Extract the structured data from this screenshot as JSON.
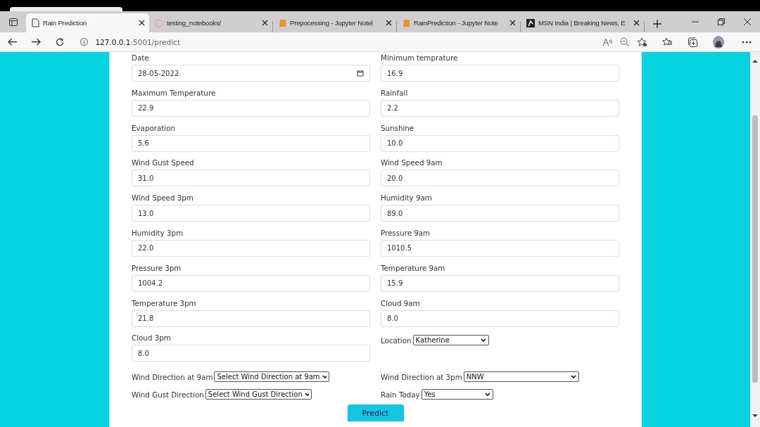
{
  "browser": {
    "tabs": [
      {
        "title": "Rain Prediction",
        "kind": "page",
        "selected": true
      },
      {
        "title": "testing_notebooks/",
        "kind": "spinner",
        "selected": false
      },
      {
        "title": "Prepocessing - Jupyter Notel",
        "kind": "book",
        "selected": false
      },
      {
        "title": "RainPrediction - Jupyter Note",
        "kind": "book",
        "selected": false
      },
      {
        "title": "MSN India | Breaking News, E",
        "kind": "msn",
        "selected": false
      }
    ],
    "address": {
      "host": "127.0.0.1",
      "path": ":5001/predict"
    }
  },
  "form": {
    "fields": [
      {
        "label": "Date",
        "value": "28-05-2022",
        "kind": "date"
      },
      {
        "label": "Minimum temprature",
        "value": "16.9",
        "kind": "input"
      },
      {
        "label": "Maximum Temperature",
        "value": "22.9",
        "kind": "input"
      },
      {
        "label": "Rainfall",
        "value": "2.2",
        "kind": "input"
      },
      {
        "label": "Evaporation",
        "value": "5.6",
        "kind": "input"
      },
      {
        "label": "Sunshine",
        "value": "10.0",
        "kind": "input"
      },
      {
        "label": "Wind Gust Speed",
        "value": "31.0",
        "kind": "input"
      },
      {
        "label": "Wind Speed 9am",
        "value": "20.0",
        "kind": "input"
      },
      {
        "label": "Wind Speed 3pm",
        "value": "13.0",
        "kind": "input"
      },
      {
        "label": "Humidity 9am",
        "value": "89.0",
        "kind": "input"
      },
      {
        "label": "Humidity 3pm",
        "value": "22.0",
        "kind": "input"
      },
      {
        "label": "Pressure 9am",
        "value": "1010.5",
        "kind": "input"
      },
      {
        "label": "Pressure 3pm",
        "value": "1004.2",
        "kind": "input"
      },
      {
        "label": "Temperature 9am",
        "value": "15.9",
        "kind": "input"
      },
      {
        "label": "Temperature 3pm",
        "value": "21.8",
        "kind": "input"
      },
      {
        "label": "Cloud 9am",
        "value": "8.0",
        "kind": "input"
      },
      {
        "label": "Cloud 3pm",
        "value": "8.0",
        "kind": "input"
      },
      {
        "label": "Location",
        "value": "Katherine",
        "kind": "select"
      },
      {
        "label": "Wind Direction at 9am",
        "value": "Select Wind Direction at 9am",
        "kind": "select"
      },
      {
        "label": "Wind Direction at 3pm",
        "value": "NNW",
        "kind": "select"
      },
      {
        "label": "Wind Gust Direction",
        "value": "Select Wind Gust Direction",
        "kind": "select"
      },
      {
        "label": "Rain Today",
        "value": "Yes",
        "kind": "select"
      }
    ],
    "submit": "Predict"
  }
}
